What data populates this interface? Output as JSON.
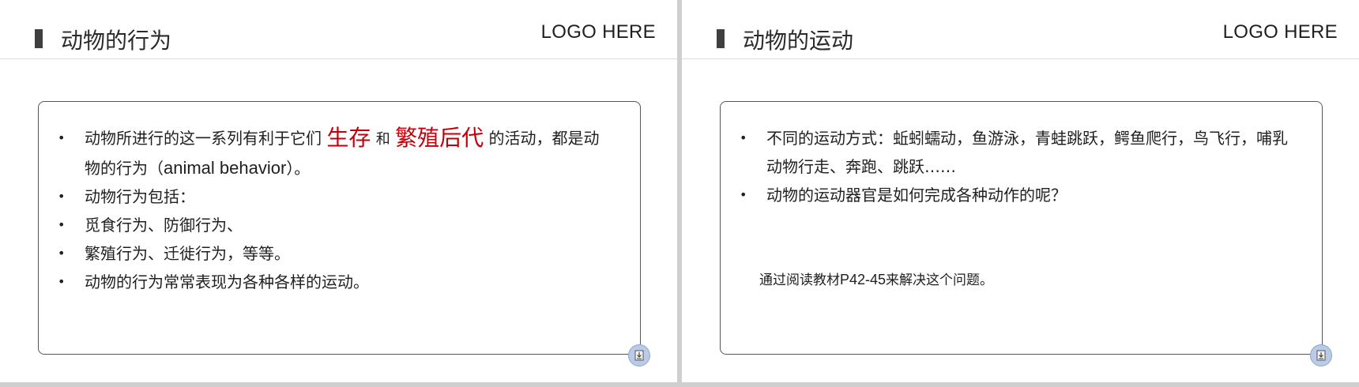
{
  "slides": [
    {
      "title": "动物的行为",
      "logo": "LOGO HERE",
      "bullet1": {
        "text_a": "动物所进行的这一系列有利于它们",
        "emph1": "生存",
        "mid": "和",
        "emph2": "繁殖后代",
        "text_b": "的活动，都是动物的行为（",
        "en": "animal behavior",
        "text_c": "）。"
      },
      "bullets": [
        "动物行为包括：",
        "觅食行为、防御行为、",
        "繁殖行为、迁徙行为，等等。",
        "动物的行为常常表现为各种各样的运动。"
      ]
    },
    {
      "title": "动物的运动",
      "logo": "LOGO HERE",
      "bullets": [
        "不同的运动方式：蚯蚓蠕动，鱼游泳，青蛙跳跃，鳄鱼爬行，鸟飞行，哺乳动物行走、奔跑、跳跃……",
        "动物的运动器官是如何完成各种动作的呢？"
      ],
      "note": {
        "text_a": "通过阅读教材",
        "code": "P42-45",
        "text_b": "来解决这个问题。"
      }
    }
  ],
  "colors": {
    "emphasis": "#c0000a",
    "card_border": "#555555",
    "button": "#b9cbe6"
  },
  "icons": {
    "corner_button": "download-icon"
  }
}
